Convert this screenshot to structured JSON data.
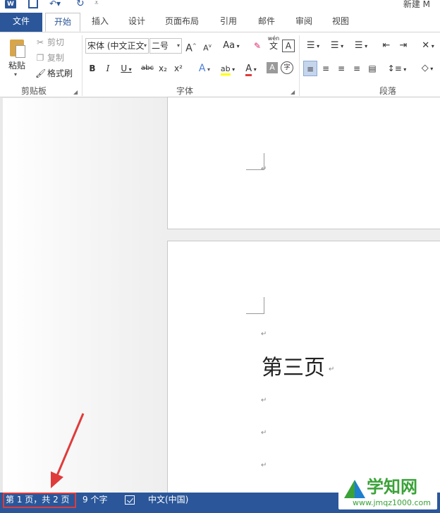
{
  "titlebar": {
    "app_logo": "W",
    "document_title": "新建 M"
  },
  "tabs": [
    {
      "label": "文件"
    },
    {
      "label": "开始"
    },
    {
      "label": "插入"
    },
    {
      "label": "设计"
    },
    {
      "label": "页面布局"
    },
    {
      "label": "引用"
    },
    {
      "label": "邮件"
    },
    {
      "label": "审阅"
    },
    {
      "label": "视图"
    }
  ],
  "ribbon": {
    "clipboard": {
      "paste_label": "粘贴",
      "cut_label": "剪切",
      "copy_label": "复制",
      "format_painter_label": "格式刷",
      "group_label": "剪贴板"
    },
    "font": {
      "font_name": "宋体 (中文正文",
      "font_size": "二号",
      "grow_label": "A",
      "shrink_label": "A",
      "change_case_label": "Aa",
      "phonetic_label": "wén",
      "phonetic_char": "文",
      "border_char": "A",
      "bold_label": "B",
      "italic_label": "I",
      "underline_label": "U",
      "strike_label": "abc",
      "subscript_label": "x₂",
      "superscript_label": "x²",
      "effect_label": "A",
      "highlight_label": "ab",
      "font_color_label": "A",
      "shading_label": "A",
      "enclose_label": "字",
      "group_label": "字体"
    },
    "paragraph": {
      "group_label": "段落"
    }
  },
  "document": {
    "heading": "第三页",
    "para_mark": "↵"
  },
  "status": {
    "page_info": "第 1 页，共 2 页",
    "word_count": "9 个字",
    "language": "中文(中国)"
  },
  "watermark": {
    "title": "学知网",
    "url": "www.jmqz1000.com"
  },
  "colors": {
    "accent": "#2b579a",
    "annotation": "#e03b3b",
    "highlight_yellow": "#ffff00",
    "font_red": "#e03b3b"
  }
}
